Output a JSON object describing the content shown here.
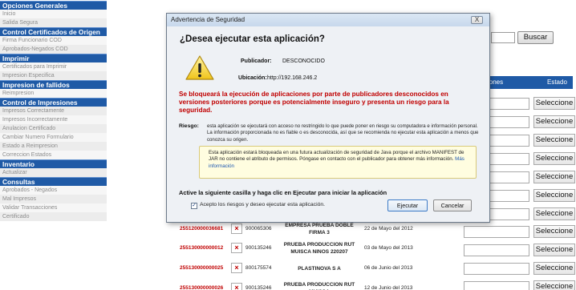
{
  "sidebar": {
    "sections": [
      {
        "title": "Opciones Generales",
        "items": [
          "Inicio",
          "Salida Segura"
        ]
      },
      {
        "title": "Control Certificados de Origen",
        "items": [
          "Firma Funcionario COD",
          "Aprobados-Negados COD"
        ]
      },
      {
        "title": "Imprimir",
        "items": [
          "Certificados para Imprimir",
          "Impresion Especifica"
        ]
      },
      {
        "title": "Impresion de fallidos",
        "items": [
          "Reimpresion"
        ]
      },
      {
        "title": "Control de Impresiones",
        "items": [
          "Impresos Correctamente",
          "Impresos Incorrectamente",
          "Anulacion Certificado",
          "Cambiar Numero Formulario",
          "Estado a Reimpresion",
          "Correccion Estados"
        ]
      },
      {
        "title": "Inventario",
        "items": [
          "Actualizar"
        ]
      },
      {
        "title": "Consultas",
        "items": [
          "Aprobados - Negados",
          "Mal Impresos",
          "Validar Transacciones",
          "Certificado"
        ]
      }
    ]
  },
  "page": {
    "search_button": "Buscar",
    "table_headers": {
      "acciones": "ciones",
      "estado": "Estado"
    },
    "select_label": "Seleccione",
    "rows": [
      {
        "code": "255120000036681",
        "nit": "900065306",
        "empresa": "EMPRESA PRUEBA DOBLE FIRMA 3",
        "fecha": "22 de Mayo del 2012"
      },
      {
        "code": "255130000000012",
        "nit": "900135246",
        "empresa": "PRUEBA PRODUCCION RUT MUISCA NINOS 220207",
        "fecha": "03 de Mayo del 2013"
      },
      {
        "code": "255130000000025",
        "nit": "800175574",
        "empresa": "PLASTINOVA S A",
        "fecha": "06 de Junio del 2013"
      },
      {
        "code": "255130000000026",
        "nit": "900135246",
        "empresa": "PRUEBA PRODUCCION RUT MUISCA",
        "fecha": "12 de Junio del 2013"
      }
    ]
  },
  "dialog": {
    "title": "Advertencia de Seguridad",
    "close_label": "X",
    "question": "¿Desea ejecutar esta aplicación?",
    "publisher_label": "Publicador:",
    "publisher_value": "DESCONOCIDO",
    "location_label": "Ubicación:",
    "location_value": "http://192.168.246.2",
    "warning": "Se bloqueará la ejecución de aplicaciones por parte de publicadores desconocidos en versiones posteriores porque es potencialmente inseguro y presenta un riesgo para la seguridad.",
    "risk_label": "Riesgo:",
    "risk_text": "esta aplicación se ejecutará con acceso no restringido lo que puede poner en riesgo su computadora e información personal. La información proporcionada no es fiable o es desconocida, así que se recomienda no ejecutar esta aplicación a menos que conozca su origen.",
    "info_text": "Esta aplicación estará bloqueada en una futura actualización de seguridad de Java porque el archivo MANIFEST de JAR no contiene el atributo de permisos. Póngase en contacto con el publicador para obtener más información.",
    "info_link": "Más información",
    "activate_text": "Active la siguiente casilla y haga clic en Ejecutar para iniciar la aplicación",
    "checkbox_label": "Acepto los riesgos y deseo ejecutar esta aplicación.",
    "checkbox_checked": true,
    "run_button": "Ejecutar",
    "cancel_button": "Cancelar"
  },
  "colors": {
    "sidebar_section": "#1f5aa6",
    "warning_text": "#c00000",
    "info_box": "#fffde0",
    "link": "#1a55b0"
  },
  "icons": {
    "warning": "warning-triangle-icon",
    "close": "close-icon",
    "delete": "x-icon"
  }
}
